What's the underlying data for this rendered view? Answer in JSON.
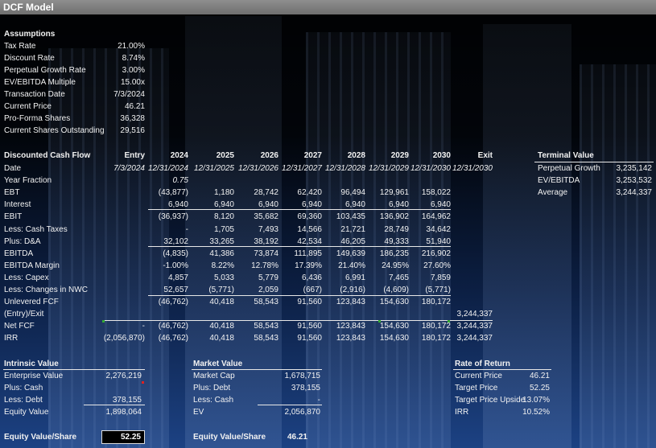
{
  "title": "DCF Model",
  "assumptions": {
    "heading": "Assumptions",
    "rows": [
      {
        "label": "Tax Rate",
        "value": "21.00%"
      },
      {
        "label": "Discount Rate",
        "value": "8.74%"
      },
      {
        "label": "Perpetual Growth Rate",
        "value": "3.00%"
      },
      {
        "label": "EV/EBITDA Multiple",
        "value": "15.00x"
      },
      {
        "label": "Transaction Date",
        "value": "7/3/2024"
      },
      {
        "label": "Current Price",
        "value": "46.21"
      },
      {
        "label": "Pro-Forma Shares",
        "value": "36,328"
      },
      {
        "label": "Current Shares Outstanding",
        "value": "29,516"
      }
    ]
  },
  "dcf": {
    "heading": "Discounted Cash Flow",
    "headers": [
      "Entry",
      "2024",
      "2025",
      "2026",
      "2027",
      "2028",
      "2029",
      "2030",
      "Exit"
    ],
    "rows": [
      {
        "label": "Date",
        "cells": [
          "7/3/2024",
          "12/31/2024",
          "12/31/2025",
          "12/31/2026",
          "12/31/2027",
          "12/31/2028",
          "12/31/2029",
          "12/31/2030",
          "12/31/2030"
        ],
        "italic": true
      },
      {
        "label": "Year Fraction",
        "cells": [
          "",
          "0.75",
          "",
          "",
          "",
          "",
          "",
          "",
          ""
        ],
        "italic": true
      },
      {
        "label": "EBT",
        "cells": [
          "",
          "(43,877)",
          "1,180",
          "28,742",
          "62,420",
          "96,494",
          "129,961",
          "158,022",
          ""
        ]
      },
      {
        "label": "Interest",
        "cells": [
          "",
          "6,940",
          "6,940",
          "6,940",
          "6,940",
          "6,940",
          "6,940",
          "6,940",
          ""
        ]
      },
      {
        "label": "EBIT",
        "cells": [
          "",
          "(36,937)",
          "8,120",
          "35,682",
          "69,360",
          "103,435",
          "136,902",
          "164,962",
          ""
        ]
      },
      {
        "label": "Less: Cash Taxes",
        "cells": [
          "",
          "-",
          "1,705",
          "7,493",
          "14,566",
          "21,721",
          "28,749",
          "34,642",
          ""
        ]
      },
      {
        "label": "Plus: D&A",
        "cells": [
          "",
          "32,102",
          "33,265",
          "38,192",
          "42,534",
          "46,205",
          "49,333",
          "51,940",
          ""
        ]
      },
      {
        "label": "EBITDA",
        "cells": [
          "",
          "(4,835)",
          "41,386",
          "73,874",
          "111,895",
          "149,639",
          "186,235",
          "216,902",
          ""
        ]
      },
      {
        "label": "EBITDA Margin",
        "cells": [
          "",
          "-1.00%",
          "8.22%",
          "12.78%",
          "17.39%",
          "21.40%",
          "24.95%",
          "27.60%",
          ""
        ]
      },
      {
        "label": "Less: Capex",
        "cells": [
          "",
          "4,857",
          "5,033",
          "5,779",
          "6,436",
          "6,991",
          "7,465",
          "7,859",
          ""
        ]
      },
      {
        "label": "Less: Changes in NWC",
        "cells": [
          "",
          "52,657",
          "(5,771)",
          "2,059",
          "(667)",
          "(2,916)",
          "(4,609)",
          "(5,771)",
          ""
        ]
      },
      {
        "label": "Unlevered FCF",
        "cells": [
          "",
          "(46,762)",
          "40,418",
          "58,543",
          "91,560",
          "123,843",
          "154,630",
          "180,172",
          ""
        ]
      },
      {
        "label": "(Entry)/Exit",
        "cells": [
          "",
          "",
          "",
          "",
          "",
          "",
          "",
          "",
          "3,244,337"
        ]
      },
      {
        "label": "Net FCF",
        "cells": [
          "-",
          "(46,762)",
          "40,418",
          "58,543",
          "91,560",
          "123,843",
          "154,630",
          "180,172",
          "3,244,337"
        ]
      },
      {
        "label": "IRR",
        "cells": [
          "(2,056,870)",
          "(46,762)",
          "40,418",
          "58,543",
          "91,560",
          "123,843",
          "154,630",
          "180,172",
          "3,244,337"
        ]
      }
    ]
  },
  "terminal": {
    "heading": "Terminal Value",
    "rows": [
      {
        "label": "Perpetual Growth",
        "value": "3,235,142"
      },
      {
        "label": "EV/EBITDA",
        "value": "3,253,532"
      },
      {
        "label": "Average",
        "value": "3,244,337"
      }
    ]
  },
  "intrinsic": {
    "heading": "Intrinsic Value",
    "rows": [
      {
        "label": "Enterprise Value",
        "value": "2,276,219"
      },
      {
        "label": "Plus: Cash",
        "value": ""
      },
      {
        "label": "Less: Debt",
        "value": "378,155"
      },
      {
        "label": "Equity Value",
        "value": "1,898,064"
      }
    ],
    "eq_label": "Equity Value/Share",
    "eq_value": "52.25"
  },
  "market": {
    "heading": "Market Value",
    "rows": [
      {
        "label": "Market Cap",
        "value": "1,678,715"
      },
      {
        "label": "Plus: Debt",
        "value": "378,155"
      },
      {
        "label": "Less: Cash",
        "value": "-"
      },
      {
        "label": "EV",
        "value": "2,056,870"
      }
    ],
    "eq_label": "Equity Value/Share",
    "eq_value": "46.21"
  },
  "ror": {
    "heading": "Rate of Return",
    "rows": [
      {
        "label": "Current Price",
        "value": "46.21"
      },
      {
        "label": "Target Price",
        "value": "52.25"
      },
      {
        "label": "Target Price Upside",
        "value": "13.07%"
      },
      {
        "label": "IRR",
        "value": "10.52%"
      }
    ]
  }
}
